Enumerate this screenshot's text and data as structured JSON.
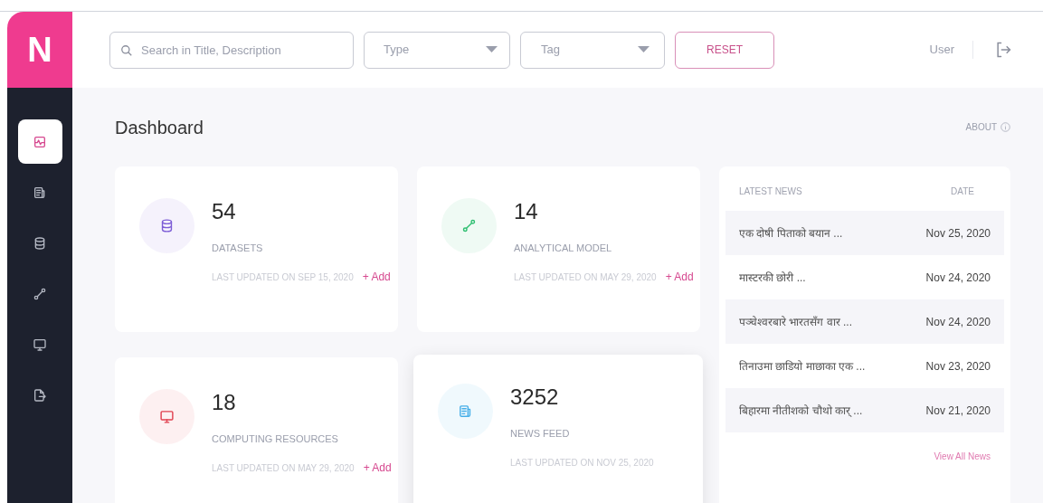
{
  "logo": "N",
  "sidebar": {
    "items": [
      {
        "kind": "activity",
        "selected": true
      },
      {
        "kind": "news",
        "selected": false
      },
      {
        "kind": "database",
        "selected": false
      },
      {
        "kind": "model",
        "selected": false
      },
      {
        "kind": "monitor",
        "selected": false
      },
      {
        "kind": "export",
        "selected": false
      }
    ]
  },
  "header": {
    "search": {
      "placeholder": "Search in Title, Description"
    },
    "type_select": {
      "placeholder": "Type"
    },
    "tag_select": {
      "placeholder": "Tag"
    },
    "reset_button": "RESET",
    "user": "User"
  },
  "page": {
    "title": "Dashboard",
    "about": "ABOUT"
  },
  "stat_cards": [
    {
      "kind": "database",
      "color": "#7c5cd6",
      "count": "54",
      "label": "DATASETS",
      "updated": "LAST UPDATED ON SEP 15, 2020",
      "add": "+ Add",
      "elevated": false
    },
    {
      "kind": "model",
      "color": "#2fbf71",
      "count": "14",
      "label": "ANALYTICAL MODEL",
      "updated": "LAST UPDATED ON MAY 29, 2020",
      "add": "+ Add",
      "elevated": false
    },
    {
      "kind": "monitor",
      "color": "#e0404f",
      "count": "18",
      "label": "COMPUTING RESOURCES",
      "updated": "LAST UPDATED ON MAY 29, 2020",
      "add": "+ Add",
      "elevated": false
    },
    {
      "kind": "news",
      "color": "#45aee8",
      "count": "3252",
      "label": "NEWS FEED",
      "updated": "LAST UPDATED ON NOV 25, 2020",
      "elevated": true
    }
  ],
  "news": {
    "columns": [
      "LATEST NEWS",
      "DATE"
    ],
    "rows": [
      {
        "title": "एक दोषी पिताको बयान ...",
        "date": "Nov 25, 2020"
      },
      {
        "title": "मास्टरकी छोरी ...",
        "date": "Nov 24, 2020"
      },
      {
        "title": "पञ्चेश्वरबारे भारतसँग वार ...",
        "date": "Nov 24, 2020"
      },
      {
        "title": "तिनाउमा छाडियो माछाका एक ...",
        "date": "Nov 23, 2020"
      },
      {
        "title": "बिहारमा नीतीशको चौथो कार् ...",
        "date": "Nov 21, 2020"
      }
    ],
    "view_all": "View All News"
  }
}
